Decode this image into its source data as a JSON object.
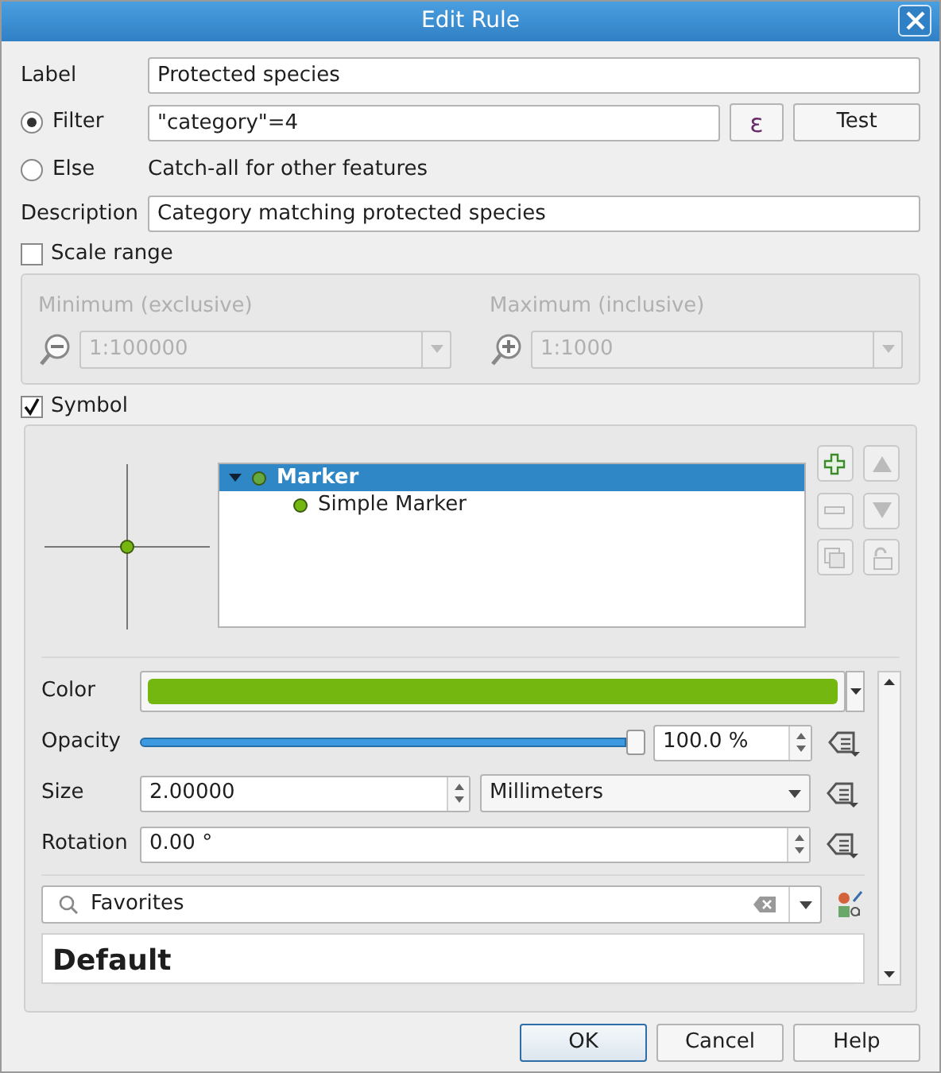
{
  "window": {
    "title": "Edit Rule"
  },
  "label_field": {
    "label": "Label",
    "value": "Protected species"
  },
  "rule_type": [
    {
      "kind": "filter",
      "label": "Filter",
      "selected": true,
      "value": "\"category\"=4"
    },
    {
      "kind": "else",
      "label": "Else",
      "selected": false,
      "note": "Catch-all for other features"
    }
  ],
  "expression_button": "ε",
  "test_button": "Test",
  "description": {
    "label": "Description",
    "value": "Category matching protected species"
  },
  "scale_range": {
    "label": "Scale range",
    "checked": false,
    "minimum": {
      "label": "Minimum (exclusive)",
      "value": "1:100000"
    },
    "maximum": {
      "label": "Maximum (inclusive)",
      "value": "1:1000"
    }
  },
  "symbol": {
    "label": "Symbol",
    "checked": true,
    "layers": [
      {
        "label": "Marker",
        "selected": true,
        "expanded": true,
        "children": [
          {
            "label": "Simple Marker",
            "selected": false
          }
        ]
      }
    ],
    "color": {
      "label": "Color",
      "color": "#74b711"
    },
    "opacity": {
      "label": "Opacity",
      "level": 1.0,
      "reading": "100.0 %"
    },
    "size": {
      "label": "Size",
      "value": "2.00000",
      "unit": "Millimeters"
    },
    "rotation": {
      "label": "Rotation",
      "value": "0.00 °"
    },
    "search": {
      "value": "Favorites"
    },
    "library_heading": "Default"
  },
  "buttons": [
    {
      "label": "OK",
      "default": true
    },
    {
      "label": "Cancel",
      "default": false
    },
    {
      "label": "Help",
      "default": false
    }
  ]
}
